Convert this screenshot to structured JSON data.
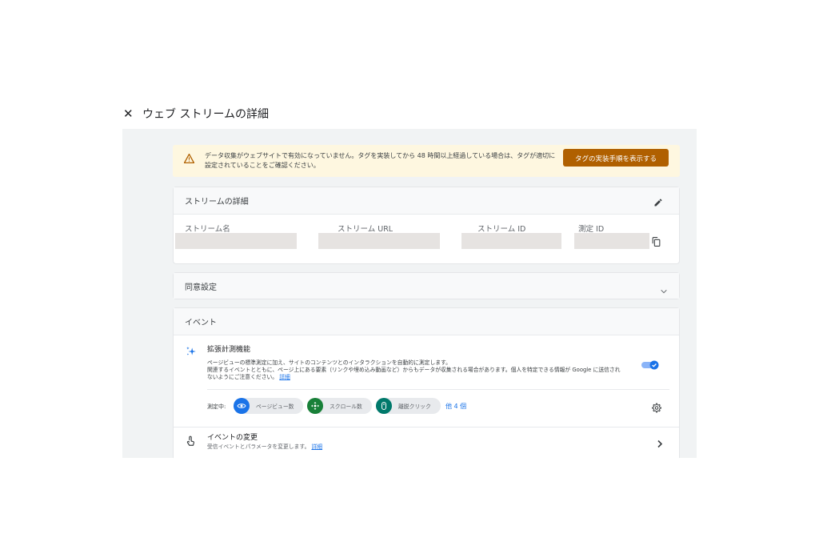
{
  "header": {
    "close_label": "✕",
    "title": "ウェブ ストリームの詳細"
  },
  "banner": {
    "message": "データ収集がウェブサイトで有効になっていません。タグを実装してから 48 時間以上経過している場合は、タグが適切に設定されていることをご確認ください。",
    "button_label": "タグの実装手順を表示する",
    "icon": "warning-icon",
    "accent_color": "#b06000"
  },
  "stream_details": {
    "title": "ストリームの詳細",
    "fields": [
      {
        "label": "ストリーム名",
        "value": ""
      },
      {
        "label": "ストリーム URL",
        "value": ""
      },
      {
        "label": "ストリーム ID",
        "value": ""
      },
      {
        "label": "測定 ID",
        "value": ""
      }
    ]
  },
  "consent": {
    "title": "同意設定"
  },
  "events": {
    "title": "イベント",
    "enhanced": {
      "title": "拡張計測機能",
      "desc_line1": "ページビューの標準測定に加え、サイトのコンテンツとのインタラクションを自動的に測定します。",
      "desc_line2": "関連するイベントとともに、ページ上にある要素（リンクや埋め込み動画など）からもデータが収集される場合があります。個人を特定できる情報が Google に送信されないようにご注意ください。",
      "desc_link": "詳細",
      "enabled": true,
      "measuring_label": "測定中:",
      "chips": [
        {
          "label": "ページビュー数",
          "icon": "eye-icon",
          "color": "#1a73e8"
        },
        {
          "label": "スクロール数",
          "icon": "crosshair-icon",
          "color": "#188038"
        },
        {
          "label": "離脱クリック",
          "icon": "mouse-icon",
          "color": "#00796b"
        }
      ],
      "more_link": "他 4 個"
    },
    "modify": {
      "title": "イベントの変更",
      "desc": "受信イベントとパラメータを変更します。",
      "link": "詳細"
    }
  }
}
